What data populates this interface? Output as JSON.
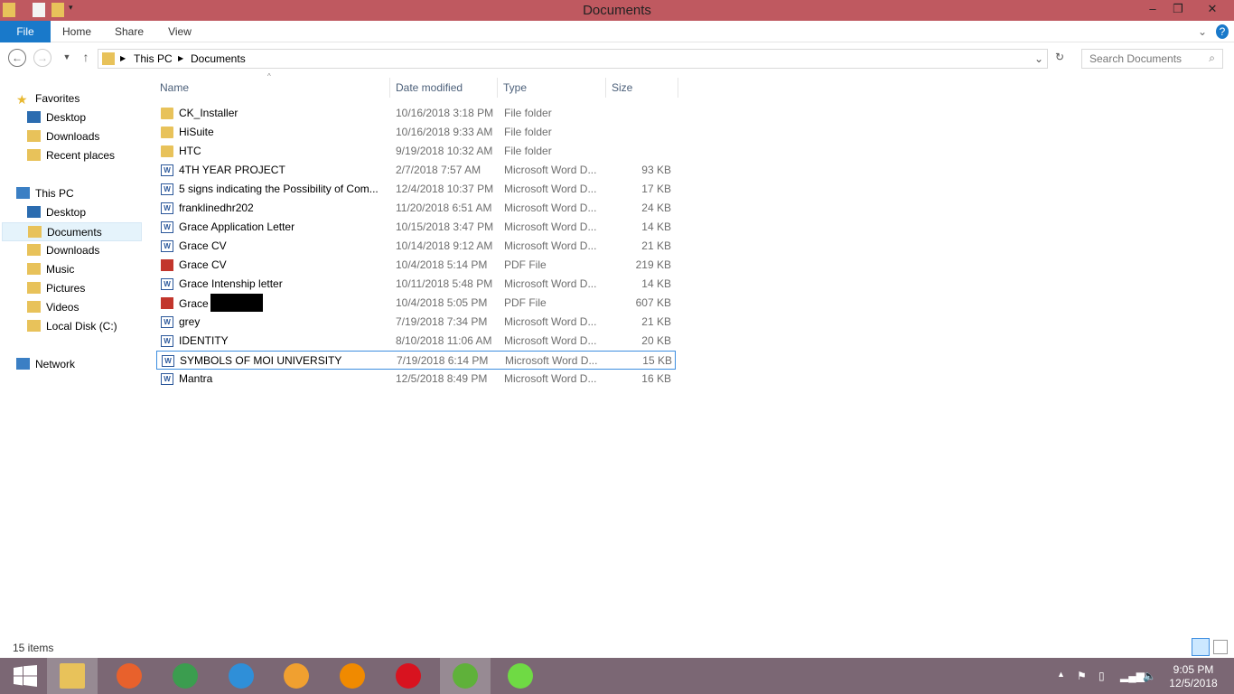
{
  "window": {
    "title": "Documents"
  },
  "ribbon": {
    "tabs": [
      "File",
      "Home",
      "Share",
      "View"
    ]
  },
  "address": {
    "crumbs": [
      "This PC",
      "Documents"
    ],
    "search_placeholder": "Search Documents"
  },
  "sidebar": {
    "items": [
      {
        "label": "Favorites",
        "level": 0
      },
      {
        "label": "Desktop",
        "level": 1
      },
      {
        "label": "Downloads",
        "level": 1
      },
      {
        "label": "Recent places",
        "level": 1
      },
      {
        "label": "This PC",
        "level": 0
      },
      {
        "label": "Desktop",
        "level": 1
      },
      {
        "label": "Documents",
        "level": 1,
        "selected": true
      },
      {
        "label": "Downloads",
        "level": 1
      },
      {
        "label": "Music",
        "level": 1
      },
      {
        "label": "Pictures",
        "level": 1
      },
      {
        "label": "Videos",
        "level": 1
      },
      {
        "label": "Local Disk (C:)",
        "level": 1
      },
      {
        "label": "Network",
        "level": 0
      }
    ]
  },
  "columns": [
    "Name",
    "Date modified",
    "Type",
    "Size"
  ],
  "files": [
    {
      "name": "CK_Installer",
      "date": "10/16/2018 3:18 PM",
      "type": "File folder",
      "size": "",
      "icon": "folder"
    },
    {
      "name": "HiSuite",
      "date": "10/16/2018 9:33 AM",
      "type": "File folder",
      "size": "",
      "icon": "folder"
    },
    {
      "name": "HTC",
      "date": "9/19/2018 10:32 AM",
      "type": "File folder",
      "size": "",
      "icon": "folder"
    },
    {
      "name": "4TH YEAR PROJECT",
      "date": "2/7/2018 7:57 AM",
      "type": "Microsoft Word D...",
      "size": "93 KB",
      "icon": "word"
    },
    {
      "name": "5 signs indicating the Possibility of Com...",
      "date": "12/4/2018 10:37 PM",
      "type": "Microsoft Word D...",
      "size": "17 KB",
      "icon": "word"
    },
    {
      "name": "franklinedhr202",
      "date": "11/20/2018 6:51 AM",
      "type": "Microsoft Word D...",
      "size": "24 KB",
      "icon": "word"
    },
    {
      "name": "Grace Application Letter",
      "date": "10/15/2018 3:47 PM",
      "type": "Microsoft Word D...",
      "size": "14 KB",
      "icon": "word"
    },
    {
      "name": "Grace CV",
      "date": "10/14/2018 9:12 AM",
      "type": "Microsoft Word D...",
      "size": "21 KB",
      "icon": "word"
    },
    {
      "name": "Grace CV",
      "date": "10/4/2018 5:14 PM",
      "type": "PDF File",
      "size": "219 KB",
      "icon": "pdf"
    },
    {
      "name": "Grace Intenship letter",
      "date": "10/11/2018 5:48 PM",
      "type": "Microsoft Word D...",
      "size": "14 KB",
      "icon": "word"
    },
    {
      "name": "Grace",
      "date": "10/4/2018 5:05 PM",
      "type": "PDF File",
      "size": "607 KB",
      "icon": "pdf",
      "redacted": true
    },
    {
      "name": "grey",
      "date": "7/19/2018 7:34 PM",
      "type": "Microsoft Word D...",
      "size": "21 KB",
      "icon": "word"
    },
    {
      "name": "IDENTITY",
      "date": "8/10/2018 11:06 AM",
      "type": "Microsoft Word D...",
      "size": "20 KB",
      "icon": "word"
    },
    {
      "name": "SYMBOLS OF MOI UNIVERSITY",
      "date": "7/19/2018 6:14 PM",
      "type": "Microsoft Word D...",
      "size": "15 KB",
      "icon": "word",
      "focused": true
    },
    {
      "name": "Mantra",
      "date": "12/5/2018 8:49 PM",
      "type": "Microsoft Word D...",
      "size": "16 KB",
      "icon": "word"
    }
  ],
  "status": {
    "count": "15 items"
  },
  "taskbar": {
    "apps": [
      {
        "name": "file-explorer",
        "color": "#e8c25a",
        "active": true
      },
      {
        "name": "firefox",
        "color": "#e8612c"
      },
      {
        "name": "chrome",
        "color": "#3b9d4f"
      },
      {
        "name": "internet-explorer",
        "color": "#2f8fd8"
      },
      {
        "name": "media-player",
        "color": "#f0a030"
      },
      {
        "name": "vlc",
        "color": "#f08a00"
      },
      {
        "name": "opera",
        "color": "#d8131f"
      },
      {
        "name": "utorrent",
        "color": "#5fb13a",
        "active": true
      },
      {
        "name": "upwork",
        "color": "#6fda44"
      }
    ],
    "time": "9:05 PM",
    "date": "12/5/2018"
  }
}
